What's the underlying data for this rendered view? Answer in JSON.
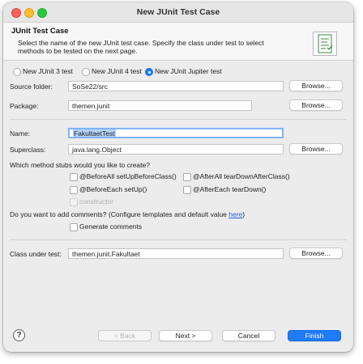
{
  "window": {
    "title": "New JUnit Test Case"
  },
  "banner": {
    "title": "JUnit Test Case",
    "description": "Select the name of the new JUnit test case. Specify the class under test to select methods to be tested on the next page."
  },
  "junit_version": {
    "options": [
      "New JUnit 3 test",
      "New JUnit 4 test",
      "New JUnit Jupiter test"
    ],
    "selected": "New JUnit Jupiter test"
  },
  "form": {
    "source_folder": {
      "label": "Source folder:",
      "value": "SoSe22/src",
      "button": "Browse..."
    },
    "package": {
      "label": "Package:",
      "value": "themen.junit",
      "button": "Browse..."
    },
    "name": {
      "label": "Name:",
      "value": "FakultaetTest"
    },
    "superclass": {
      "label": "Superclass:",
      "value": "java.lang.Object",
      "button": "Browse..."
    },
    "class_under_test": {
      "label": "Class under test:",
      "value": "themen.junit.Fakultaet",
      "button": "Browse..."
    }
  },
  "method_stubs": {
    "question": "Which method stubs would you like to create?",
    "options": [
      {
        "label": "@BeforeAll setUpBeforeClass()",
        "checked": false
      },
      {
        "label": "@AfterAll tearDownAfterClass()",
        "checked": false
      },
      {
        "label": "@BeforeEach setUp()",
        "checked": false
      },
      {
        "label": "@AfterEach tearDown()",
        "checked": false
      },
      {
        "label": "constructor",
        "checked": false,
        "disabled": true
      }
    ]
  },
  "comments": {
    "question": "Do you want to add comments? (Configure templates and default value ",
    "link": "here",
    "question_end": ")",
    "option": {
      "label": "Generate comments",
      "checked": false
    }
  },
  "footer": {
    "help_label": "?",
    "back": "< Back",
    "next": "Next >",
    "cancel": "Cancel",
    "finish": "Finish"
  },
  "colors": {
    "accent": "#1f7bf6",
    "focus_ring": "#7fb4f5",
    "selection": "#b4d3fb"
  },
  "icons": [
    "close-icon",
    "minimize-icon",
    "zoom-icon",
    "junit-wizard-icon",
    "help-icon"
  ]
}
